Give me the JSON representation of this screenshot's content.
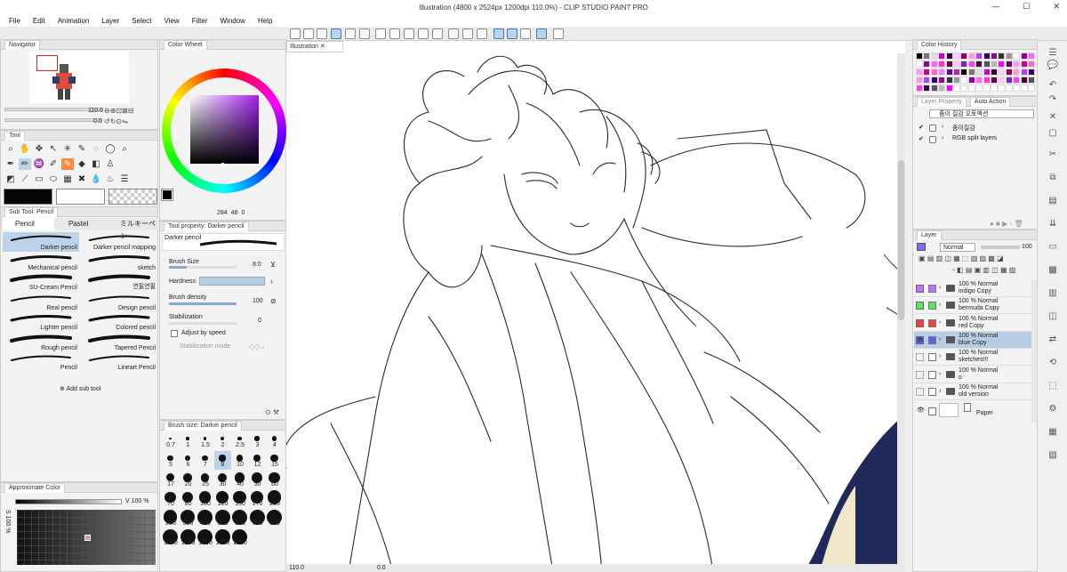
{
  "window": {
    "title": "Illustration (4800 x 2524px 1200dpi 110.0%) - CLIP STUDIO PAINT PRO",
    "minimize": "—",
    "maximize": "☐",
    "close": "✕"
  },
  "menu": [
    "File",
    "Edit",
    "Animation",
    "Layer",
    "Select",
    "View",
    "Filter",
    "Window",
    "Help"
  ],
  "navigator": {
    "title": "Navigator",
    "zoom": "110.0",
    "rotation": "0.0"
  },
  "color_wheel": {
    "title": "Color Wheel",
    "h": "284",
    "s": "48",
    "v": "0"
  },
  "tool_panel": {
    "title": "Tool"
  },
  "sub_tool": {
    "title": "Sub Tool: Pencil",
    "tabs": [
      "Pencil",
      "Pastel",
      "ミルキーペン"
    ],
    "brushes": [
      [
        "Darker pencil",
        "Darker pencil mapping"
      ],
      [
        "Mechanical pencil",
        "sketch"
      ],
      [
        "SU-Cream Pencil",
        "연필연필"
      ],
      [
        "Real pencil",
        "Design pencil"
      ],
      [
        "Lighter pencil",
        "Colored pencil"
      ],
      [
        "Rough pencil",
        "Tapered Pencil"
      ],
      [
        "Pencil",
        "Lineart Pencil"
      ]
    ],
    "add": "Add sub tool"
  },
  "tool_property": {
    "title": "Tool property: Darker pencil",
    "brush_name": "Darker pencil",
    "brush_size_label": "Brush Size",
    "brush_size": "8.0",
    "hardness_label": "Hardness",
    "density_label": "Brush density",
    "density": "100",
    "stabilization_label": "Stabilization",
    "stabilization": "0",
    "adjust_speed": "Adjust by speed",
    "stab_mode": "Stabilization mode"
  },
  "brush_size_panel": {
    "title": "Brush size: Darker pencil",
    "sizes": [
      "0.7",
      "1",
      "1.5",
      "2",
      "2.5",
      "3",
      "4",
      "5",
      "6",
      "7",
      "8",
      "10",
      "12",
      "15",
      "17",
      "20",
      "25",
      "30",
      "40",
      "50",
      "60",
      "70",
      "80",
      "100",
      "120",
      "150",
      "170",
      "200",
      "250",
      "300",
      "400",
      "500",
      "600",
      "700",
      "800",
      "1000",
      "1200",
      "1500",
      "1700",
      "2000"
    ],
    "selected": "8"
  },
  "approx_color": {
    "title": "Approximate Color",
    "v_label": "V 100 %",
    "s_label": "S 100 %"
  },
  "document": {
    "tab": "Illustration",
    "zoom": "110.0",
    "angle": "0.0"
  },
  "color_history": {
    "title": "Color History"
  },
  "layer_property": {
    "title": "Layer Property",
    "auto_action": "Auto Action",
    "dropdown": "좀이 질감 오토액션",
    "items": [
      "좀이질감",
      "RGB split layers"
    ]
  },
  "layer_panel": {
    "title": "Layer",
    "blend": "Normal",
    "opacity": "100",
    "layers": [
      {
        "l1": "100 % Normal",
        "l2": "indigo Copy",
        "color": "#c070ff"
      },
      {
        "l1": "100 % Normal",
        "l2": "bermuda Copy",
        "color": "#60e060"
      },
      {
        "l1": "100 % Normal",
        "l2": "red Copy",
        "color": "#f04040"
      },
      {
        "l1": "100 % Normal",
        "l2": "blue Copy",
        "color": "#6060e8"
      },
      {
        "l1": "100 % Normal",
        "l2": "sketches!!!",
        "color": ""
      },
      {
        "l1": "100 % Normal",
        "l2": "o",
        "color": ""
      },
      {
        "l1": "100 % Normal",
        "l2": "old version",
        "color": ""
      }
    ],
    "paper": "Paper"
  },
  "colors": {
    "accent_orange": "#ff8a3d",
    "select_blue": "#b8cce4",
    "wheel_square": "#a020f0"
  }
}
